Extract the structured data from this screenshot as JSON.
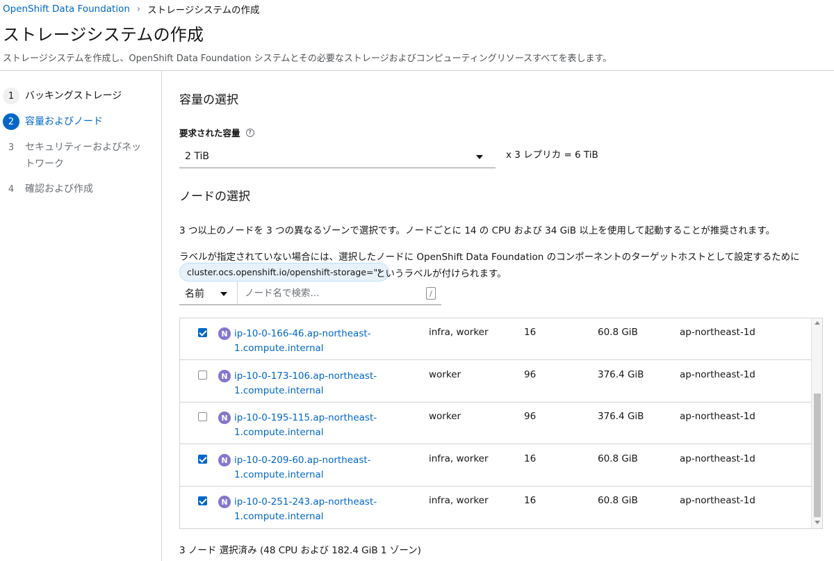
{
  "breadcrumb": {
    "root": "OpenShift Data Foundation",
    "separator": "›",
    "current": "ストレージシステムの作成"
  },
  "page": {
    "title": "ストレージシステムの作成",
    "description": "ストレージシステムを作成し、OpenShift Data Foundation システムとその必要なストレージおよびコンピューティングリソースすべてを表します。"
  },
  "steps": [
    {
      "num": "1",
      "label": "バッキングストレージ",
      "state": "done"
    },
    {
      "num": "2",
      "label": "容量およびノード",
      "state": "active"
    },
    {
      "num": "3",
      "label": "セキュリティーおよびネットワーク",
      "state": "pending"
    },
    {
      "num": "4",
      "label": "確認および作成",
      "state": "pending"
    }
  ],
  "capacity": {
    "title": "容量の選択",
    "label": "要求された容量",
    "selected": "2 TiB",
    "replica_text": "x 3 レプリカ = 6 TiB"
  },
  "nodes": {
    "title": "ノードの選択",
    "para1": "3 つ以上のノードを 3 つの異なるゾーンで選択です。ノードごとに 14 の CPU および 34 GiB 以上を使用して起動することが推奨されます。",
    "para2": "ラベルが指定されていない場合には、選択したノードに OpenShift Data Foundation のコンポーネントのターゲットホストとして設定するために",
    "label_chip": "cluster.ocs.openshift.io/openshift-storage=\"\"",
    "chip_suffix": "というラベルが付けられます。",
    "filter": {
      "attribute": "名前",
      "placeholder": "ノード名で検索...",
      "shortcut": "/"
    },
    "rows": [
      {
        "checked": true,
        "badge": "N",
        "name": "ip-10-0-166-46.ap-northeast-1.compute.internal",
        "role": "infra, worker",
        "cpu": "16",
        "memory": "60.8 GiB",
        "zone": "ap-northeast-1d"
      },
      {
        "checked": false,
        "badge": "N",
        "name": "ip-10-0-173-106.ap-northeast-1.compute.internal",
        "role": "worker",
        "cpu": "96",
        "memory": "376.4 GiB",
        "zone": "ap-northeast-1d"
      },
      {
        "checked": false,
        "badge": "N",
        "name": "ip-10-0-195-115.ap-northeast-1.compute.internal",
        "role": "worker",
        "cpu": "96",
        "memory": "376.4 GiB",
        "zone": "ap-northeast-1d"
      },
      {
        "checked": true,
        "badge": "N",
        "name": "ip-10-0-209-60.ap-northeast-1.compute.internal",
        "role": "infra, worker",
        "cpu": "16",
        "memory": "60.8 GiB",
        "zone": "ap-northeast-1d"
      },
      {
        "checked": true,
        "badge": "N",
        "name": "ip-10-0-251-243.ap-northeast-1.compute.internal",
        "role": "infra, worker",
        "cpu": "16",
        "memory": "60.8 GiB",
        "zone": "ap-northeast-1d"
      }
    ],
    "summary": "3 ノード 選択済み (48 CPU および 182.4 GiB 1 ゾーン)"
  },
  "colors": {
    "link": "#0066cc",
    "active_step": "#0066cc",
    "node_badge": "#8476d1",
    "chip_bg": "#e7f1fa"
  }
}
